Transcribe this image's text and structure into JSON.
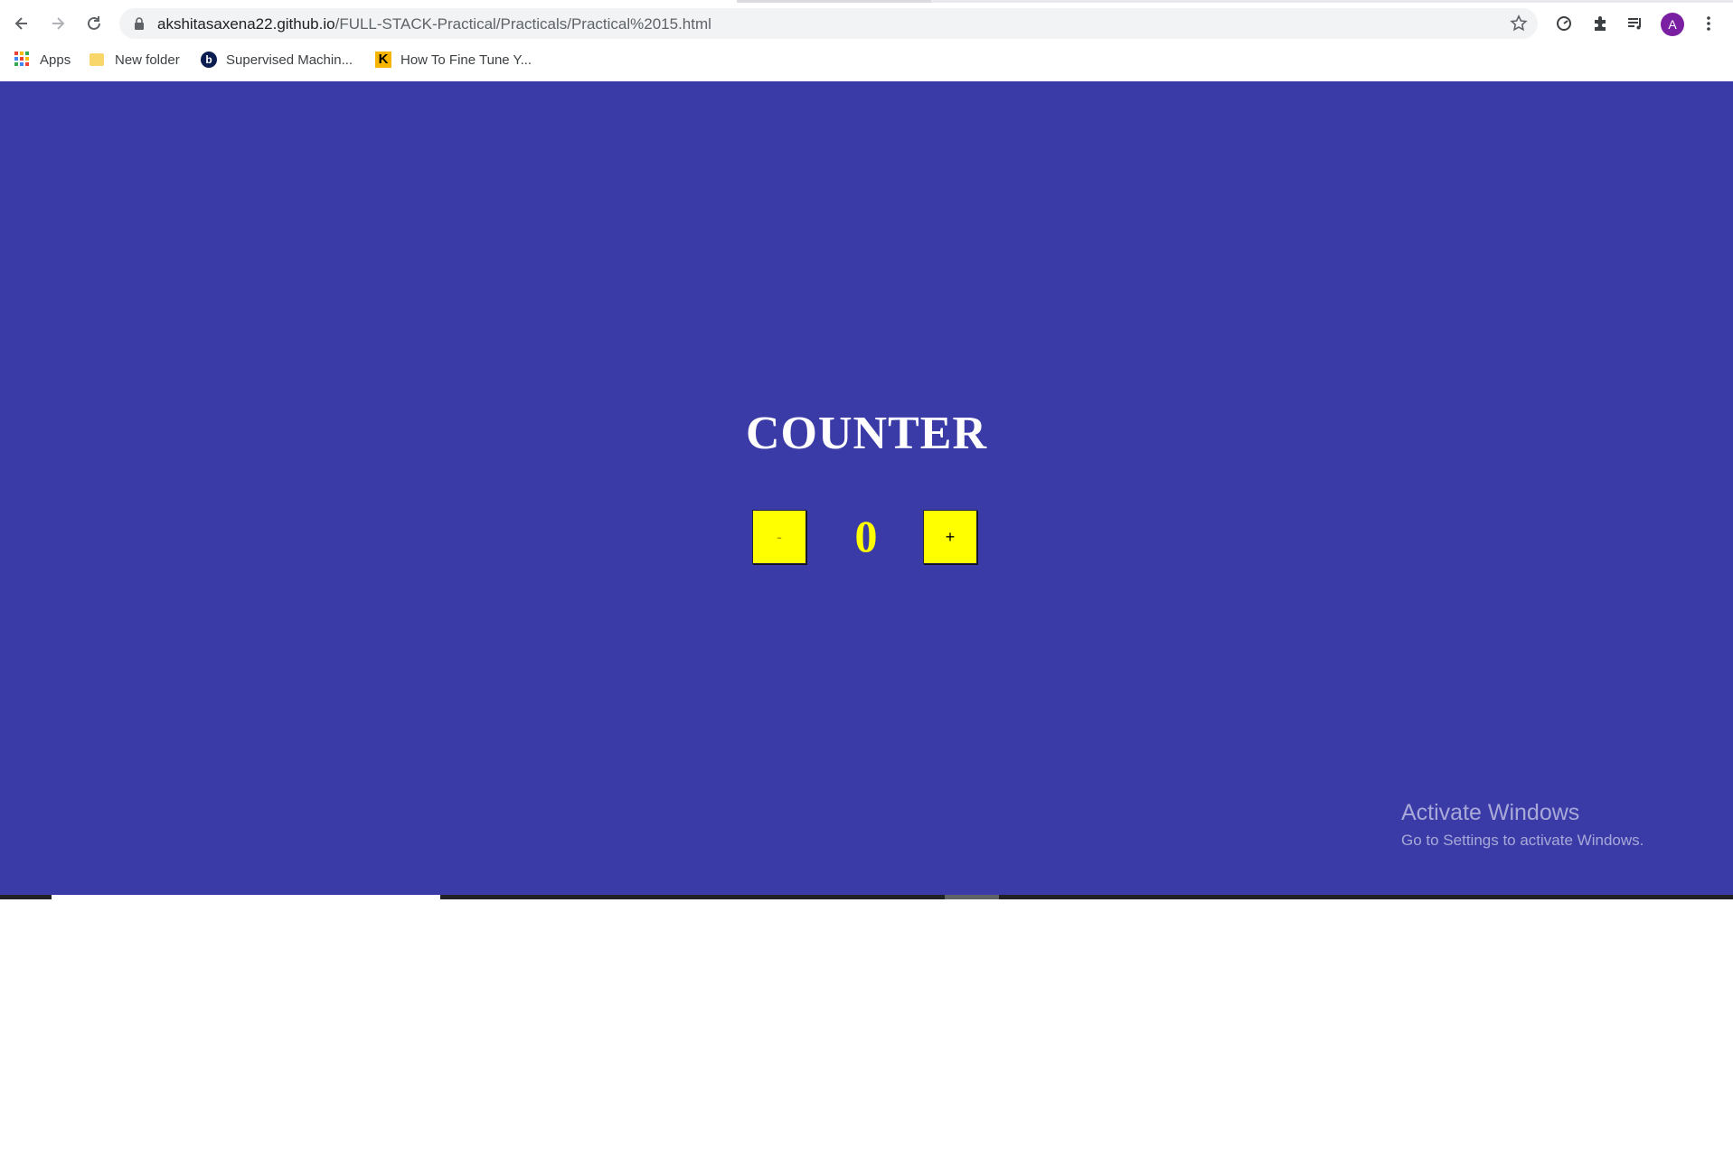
{
  "browser": {
    "url_host": "akshitasaxena22.github.io",
    "url_path": "/FULL-STACK-Practical/Practicals/Practical%2015.html",
    "avatar_letter": "A",
    "bookmarks": [
      {
        "label": "Apps",
        "icon": "apps-grid-icon"
      },
      {
        "label": "New folder",
        "icon": "folder-icon"
      },
      {
        "label": "Supervised Machin...",
        "icon": "b-site-icon"
      },
      {
        "label": "How To Fine Tune Y...",
        "icon": "k-site-icon"
      }
    ]
  },
  "page": {
    "background": "#3a3ba6",
    "title": "COUNTER",
    "minus_label": "-",
    "plus_label": "+",
    "count": "0",
    "accent": "#ffff00"
  },
  "watermark": {
    "line1": "Activate Windows",
    "line2": "Go to Settings to activate Windows."
  }
}
